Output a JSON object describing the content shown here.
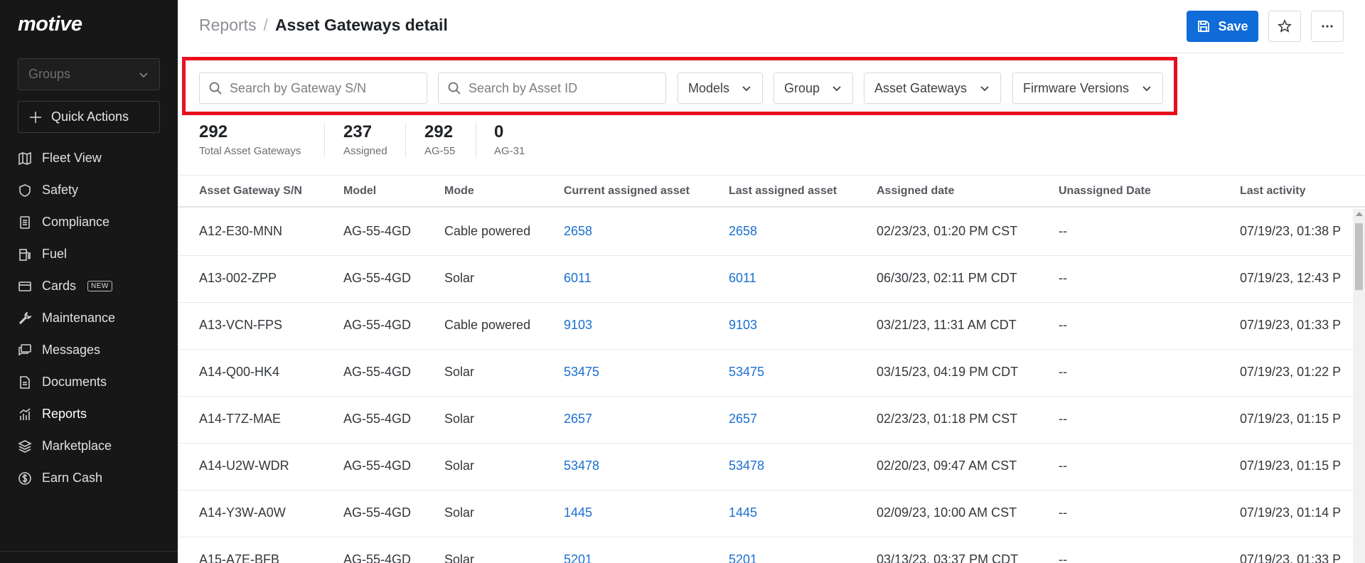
{
  "brand": {
    "logo_text": "motive"
  },
  "sidebar": {
    "groups_placeholder": "Groups",
    "quick_actions_label": "Quick Actions",
    "items": [
      {
        "label": "Fleet View",
        "icon": "map-icon"
      },
      {
        "label": "Safety",
        "icon": "shield-icon"
      },
      {
        "label": "Compliance",
        "icon": "document-list-icon"
      },
      {
        "label": "Fuel",
        "icon": "fuel-pump-icon"
      },
      {
        "label": "Cards",
        "icon": "credit-card-icon",
        "badge": "NEW"
      },
      {
        "label": "Maintenance",
        "icon": "wrench-icon"
      },
      {
        "label": "Messages",
        "icon": "messages-icon"
      },
      {
        "label": "Documents",
        "icon": "document-icon"
      },
      {
        "label": "Reports",
        "icon": "reports-chart-icon",
        "active": true
      },
      {
        "label": "Marketplace",
        "icon": "layers-icon"
      },
      {
        "label": "Earn Cash",
        "icon": "dollar-coin-icon"
      }
    ]
  },
  "header": {
    "breadcrumb_parent": "Reports",
    "breadcrumb_separator": "/",
    "title": "Asset Gateways detail",
    "save_label": "Save"
  },
  "filters": {
    "gateway_search_placeholder": "Search by Gateway S/N",
    "asset_search_placeholder": "Search by Asset ID",
    "models_label": "Models",
    "group_label": "Group",
    "asset_gateways_label": "Asset Gateways",
    "firmware_label": "Firmware Versions"
  },
  "stats": [
    {
      "value": "292",
      "label": "Total Asset Gateways"
    },
    {
      "value": "237",
      "label": "Assigned"
    },
    {
      "value": "292",
      "label": "AG-55"
    },
    {
      "value": "0",
      "label": "AG-31"
    }
  ],
  "table": {
    "columns": [
      "Asset Gateway S/N",
      "Model",
      "Mode",
      "Current assigned asset",
      "Last assigned asset",
      "Assigned date",
      "Unassigned Date",
      "Last activity"
    ],
    "rows": [
      [
        "A12-E30-MNN",
        "AG-55-4GD",
        "Cable powered",
        "2658",
        "2658",
        "02/23/23, 01:20 PM CST",
        "--",
        "07/19/23, 01:38 P"
      ],
      [
        "A13-002-ZPP",
        "AG-55-4GD",
        "Solar",
        "6011",
        "6011",
        "06/30/23, 02:11 PM CDT",
        "--",
        "07/19/23, 12:43 P"
      ],
      [
        "A13-VCN-FPS",
        "AG-55-4GD",
        "Cable powered",
        "9103",
        "9103",
        "03/21/23, 11:31 AM CDT",
        "--",
        "07/19/23, 01:33 P"
      ],
      [
        "A14-Q00-HK4",
        "AG-55-4GD",
        "Solar",
        "53475",
        "53475",
        "03/15/23, 04:19 PM CDT",
        "--",
        "07/19/23, 01:22 P"
      ],
      [
        "A14-T7Z-MAE",
        "AG-55-4GD",
        "Solar",
        "2657",
        "2657",
        "02/23/23, 01:18 PM CST",
        "--",
        "07/19/23, 01:15 P"
      ],
      [
        "A14-U2W-WDR",
        "AG-55-4GD",
        "Solar",
        "53478",
        "53478",
        "02/20/23, 09:47 AM CST",
        "--",
        "07/19/23, 01:15 P"
      ],
      [
        "A14-Y3W-A0W",
        "AG-55-4GD",
        "Solar",
        "1445",
        "1445",
        "02/09/23, 10:00 AM CST",
        "--",
        "07/19/23, 01:14 P"
      ],
      [
        "A15-A7E-BFB",
        "AG-55-4GD",
        "Solar",
        "5201",
        "5201",
        "03/13/23, 03:37 PM CDT",
        "--",
        "07/19/23, 01:33 P"
      ]
    ]
  },
  "colors": {
    "accent": "#0f6cd8",
    "link": "#1a6fd1",
    "highlight": "#e8101e",
    "sidebar_bg": "#171717"
  }
}
